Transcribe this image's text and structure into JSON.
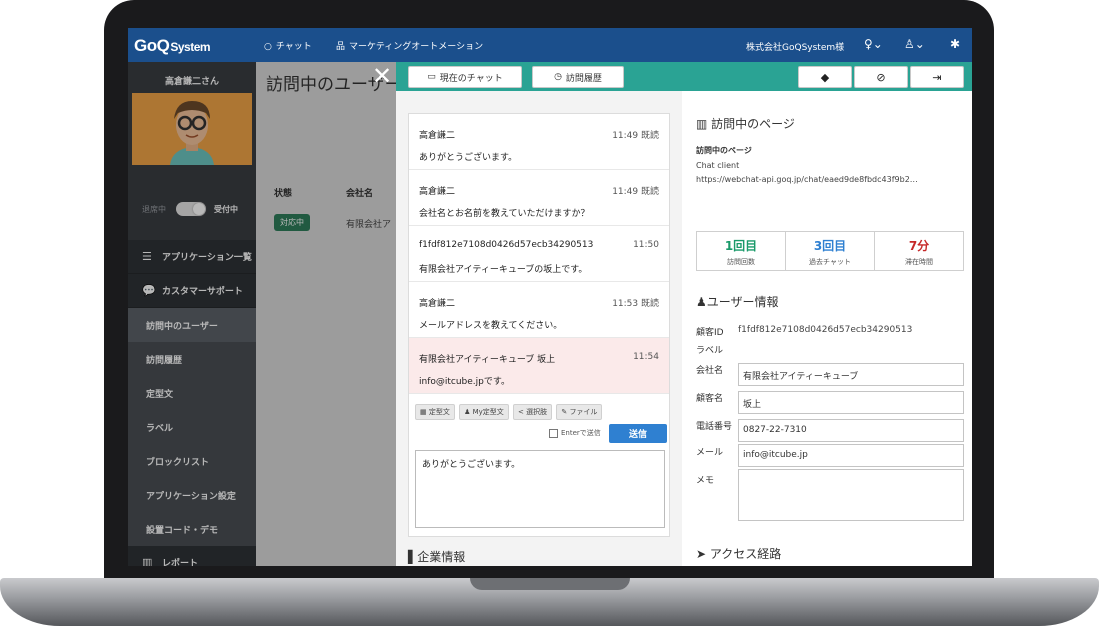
{
  "topbar": {
    "logo_main": "GoQ",
    "logo_sub": "System",
    "chat_label": "チャット",
    "ma_label": "マーケティングオートメーション",
    "company": "株式会社GoQSystem様"
  },
  "sidebar": {
    "user_name": "高倉謙二さん",
    "status_off": "退席中",
    "status_on": "受付中",
    "menu": [
      {
        "label": "アプリケーション一覧",
        "icon": "grid-icon"
      },
      {
        "label": "カスタマーサポート",
        "icon": "chat-bubble-icon"
      }
    ],
    "submenu": [
      {
        "label": "訪問中のユーザー"
      },
      {
        "label": "訪問履歴"
      },
      {
        "label": "定型文"
      },
      {
        "label": "ラベル"
      },
      {
        "label": "ブロックリスト"
      },
      {
        "label": "アプリケーション設定"
      },
      {
        "label": "設置コード・デモ"
      }
    ],
    "report": "レポート"
  },
  "page": {
    "title": "訪問中のユーザー",
    "col_status": "状態",
    "col_company": "会社名",
    "row_badge": "対応中",
    "row_company": "有限会社ア"
  },
  "modal": {
    "tab_current_chat": "現在のチャット",
    "tab_history": "訪問履歴",
    "messages": [
      {
        "who": "高倉謙二",
        "time": "11:49 既読",
        "text": "ありがとうございます。"
      },
      {
        "who": "高倉謙二",
        "time": "11:49 既読",
        "text": "会社名とお名前を教えていただけますか？"
      },
      {
        "who": "f1fdf812e7108d0426d57ecb34290513",
        "time": "11:50",
        "text": "有限会社アイティーキューブの坂上です。"
      },
      {
        "who": "高倉謙二",
        "time": "11:53 既読",
        "text": "メールアドレスを教えてください。"
      },
      {
        "who": "有限会社アイティーキューブ 坂上",
        "time": "11:54",
        "text": "info@itcube.jpです。"
      }
    ],
    "tools": [
      "定型文",
      "My定型文",
      "選択肢",
      "ファイル"
    ],
    "enter_label": "Enterで送信",
    "send_label": "送信",
    "draft": "ありがとうございます。",
    "company_info": "企業情報"
  },
  "info": {
    "visiting_title": "訪問中のページ",
    "visiting_label": "訪問中のページ",
    "page_name": "Chat client",
    "page_url": "https://webchat-api.goq.jp/chat/eaed9de8fbdc43f9b2…",
    "stats": [
      {
        "value": "1回目",
        "key": "訪問回数",
        "color": "#1a9a6a"
      },
      {
        "value": "3回目",
        "key": "過去チャット",
        "color": "#2f80d1"
      },
      {
        "value": "7分",
        "key": "滞在時間",
        "color": "#c62828"
      }
    ],
    "user_title": "ユーザー情報",
    "customer_id_label": "顧客ID",
    "customer_id": "f1fdf812e7108d0426d57ecb34290513",
    "label_label": "ラベル",
    "company_label": "会社名",
    "company_value": "有限会社アイティーキューブ",
    "name_label": "顧客名",
    "name_value": "坂上",
    "phone_label": "電話番号",
    "phone_value": "0827-22-7310",
    "mail_label": "メール",
    "mail_value": "info@itcube.jp",
    "memo_label": "メモ",
    "access_title": "アクセス経路"
  }
}
